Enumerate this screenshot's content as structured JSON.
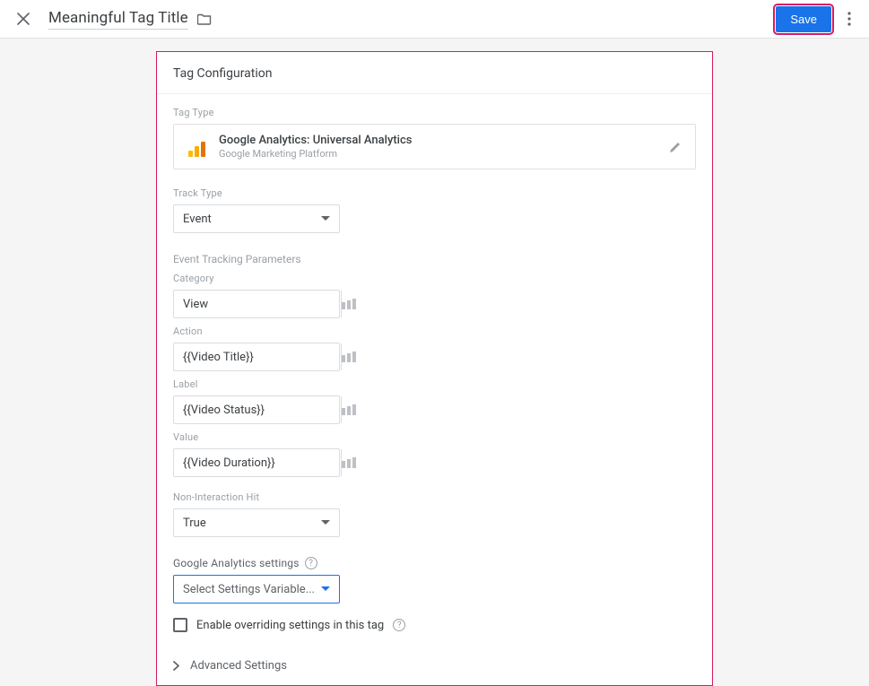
{
  "header": {
    "title": "Meaningful Tag Title",
    "save_label": "Save"
  },
  "panel": {
    "title": "Tag Configuration",
    "tag_type_label": "Tag Type",
    "tag_type": {
      "name": "Google Analytics: Universal Analytics",
      "platform": "Google Marketing Platform"
    },
    "track_type_label": "Track Type",
    "track_type_value": "Event",
    "event_params_label": "Event Tracking Parameters",
    "fields": {
      "category": {
        "label": "Category",
        "value": "View"
      },
      "action": {
        "label": "Action",
        "value": "{{Video Title}}"
      },
      "label": {
        "label": "Label",
        "value": "{{Video Status}}"
      },
      "value": {
        "label": "Value",
        "value": "{{Video Duration}}"
      }
    },
    "non_interaction_label": "Non-Interaction Hit",
    "non_interaction_value": "True",
    "ga_settings_label": "Google Analytics settings",
    "ga_settings_placeholder": "Select Settings Variable...",
    "override_label": "Enable overriding settings in this tag",
    "advanced_label": "Advanced Settings"
  }
}
